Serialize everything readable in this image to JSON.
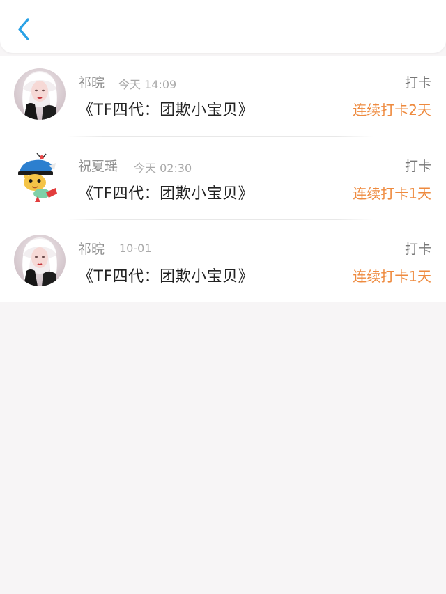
{
  "header": {
    "back_icon": "chevron-left-icon",
    "accent": "#2aa2e6"
  },
  "entries": [
    {
      "name": "祁晥",
      "time": "今天 14:09",
      "title": "《TF四代：团欺小宝贝》",
      "action": "打卡",
      "streak": "连续打卡2天"
    },
    {
      "name": "祝夏瑶",
      "time": "今天 02:30",
      "title": "《TF四代：团欺小宝贝》",
      "action": "打卡",
      "streak": "连续打卡1天"
    },
    {
      "name": "祁晥",
      "time": "10-01",
      "title": "《TF四代：团欺小宝贝》",
      "action": "打卡",
      "streak": "连续打卡1天"
    }
  ],
  "colors": {
    "streak": "#ee8a3e",
    "background": "#f7f5f6"
  }
}
